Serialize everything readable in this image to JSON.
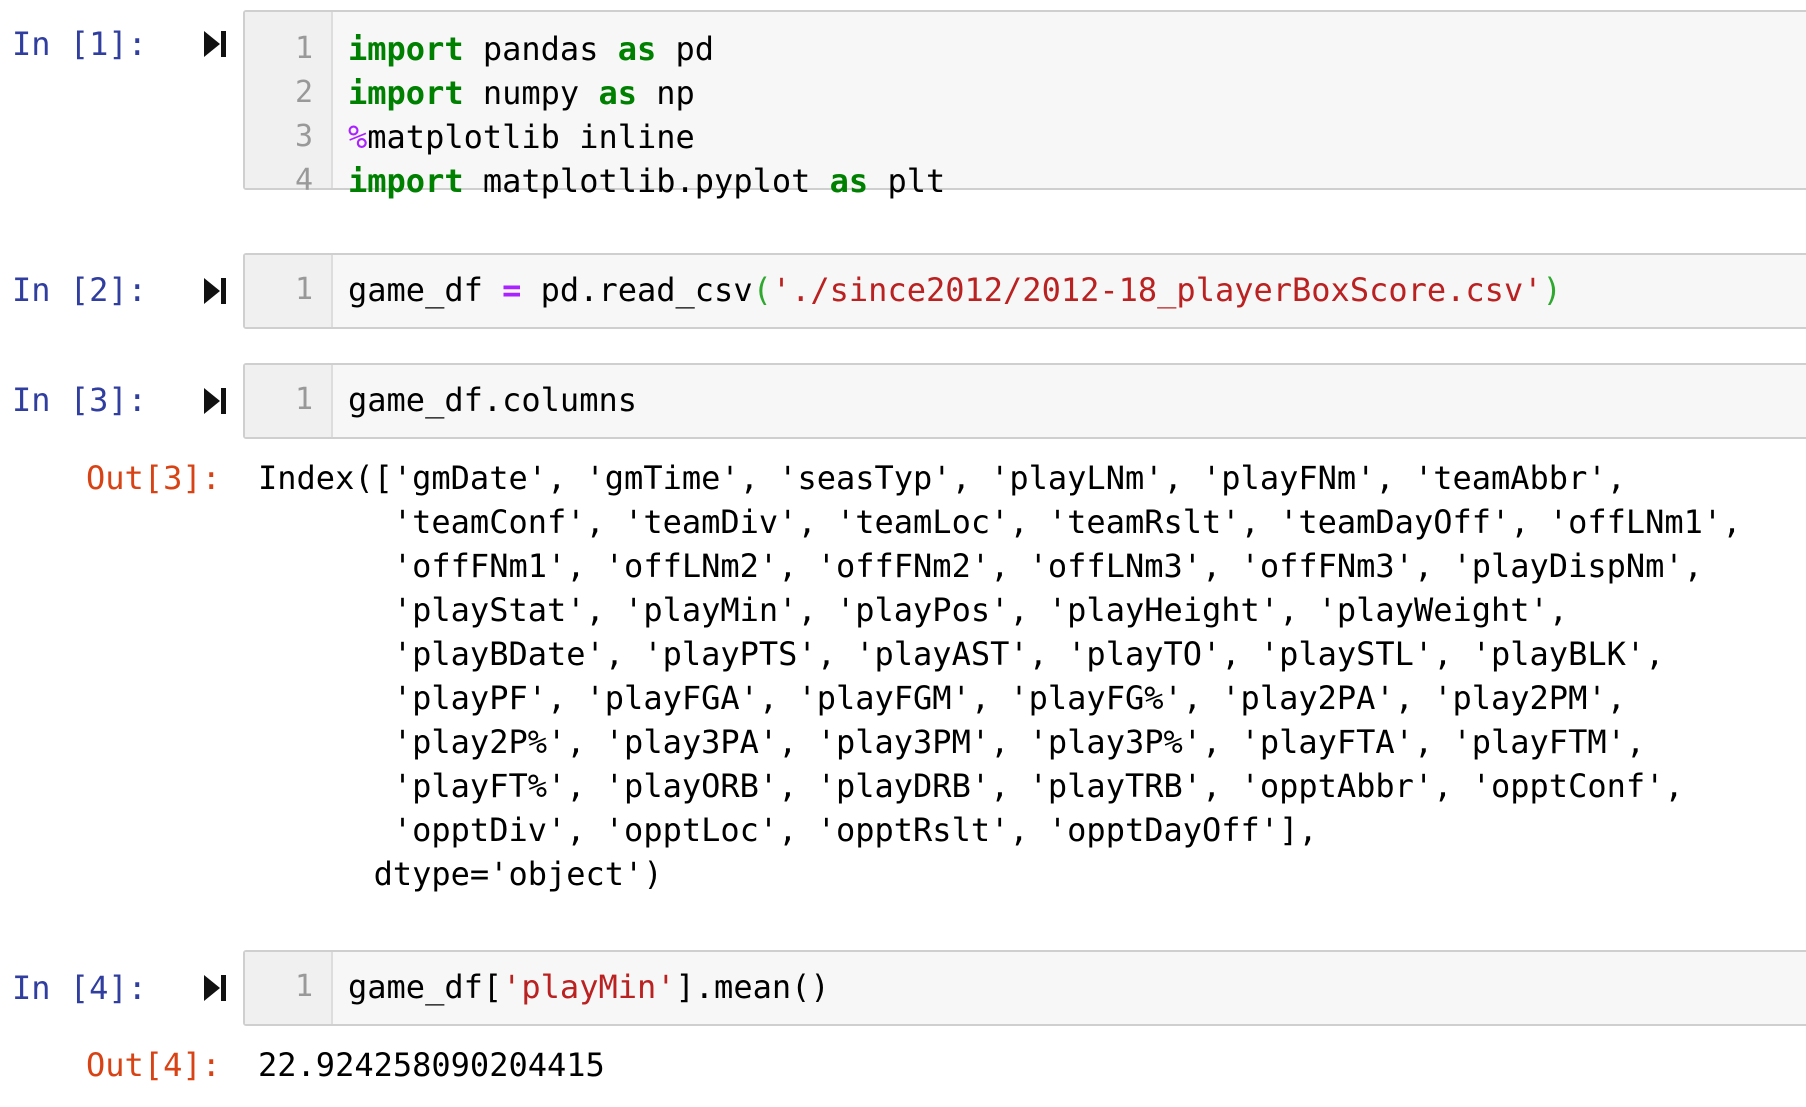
{
  "cells": [
    {
      "prompt": "In [1]:",
      "lines": [
        {
          "number": "1",
          "kw1": "import",
          "t1": " pandas ",
          "kw2": "as",
          "t2": " pd"
        },
        {
          "number": "2",
          "kw1": "import",
          "t1": " numpy ",
          "kw2": "as",
          "t2": " np"
        },
        {
          "number": "3",
          "magic": "%",
          "t1": "matplotlib inline"
        },
        {
          "number": "4",
          "kw1": "import",
          "t1": " matplotlib.pyplot ",
          "kw2": "as",
          "t2": " plt"
        }
      ]
    },
    {
      "prompt": "In [2]:",
      "line": {
        "number": "1",
        "pre": "game_df ",
        "op": "=",
        "mid": " pd.read_csv",
        "lparen": "(",
        "str": "'./since2012/2012-18_playerBoxScore.csv'",
        "rparen": ")"
      }
    },
    {
      "prompt": "In [3]:",
      "line": {
        "number": "1",
        "code": "game_df.columns"
      },
      "out_prompt": "Out[3]:",
      "output_lines": [
        "Index(['gmDate', 'gmTime', 'seasTyp', 'playLNm', 'playFNm', 'teamAbbr',",
        "       'teamConf', 'teamDiv', 'teamLoc', 'teamRslt', 'teamDayOff', 'offLNm1',",
        "       'offFNm1', 'offLNm2', 'offFNm2', 'offLNm3', 'offFNm3', 'playDispNm',",
        "       'playStat', 'playMin', 'playPos', 'playHeight', 'playWeight',",
        "       'playBDate', 'playPTS', 'playAST', 'playTO', 'playSTL', 'playBLK',",
        "       'playPF', 'playFGA', 'playFGM', 'playFG%', 'play2PA', 'play2PM',",
        "       'play2P%', 'play3PA', 'play3PM', 'play3P%', 'playFTA', 'playFTM',",
        "       'playFT%', 'playORB', 'playDRB', 'playTRB', 'opptAbbr', 'opptConf',",
        "       'opptDiv', 'opptLoc', 'opptRslt', 'opptDayOff'],",
        "      dtype='object')"
      ]
    },
    {
      "prompt": "In [4]:",
      "line": {
        "number": "1",
        "pre": "game_df[",
        "str": "'playMin'",
        "post": "].mean()"
      },
      "out_prompt": "Out[4]:",
      "output": "22.924258090204415"
    }
  ],
  "icons": {
    "run": "run-cell-icon"
  },
  "colors": {
    "in_prompt": "#303F9F",
    "out_prompt": "#D84315",
    "keyword": "#008000",
    "magic": "#AA22FF",
    "string": "#BA2121"
  }
}
